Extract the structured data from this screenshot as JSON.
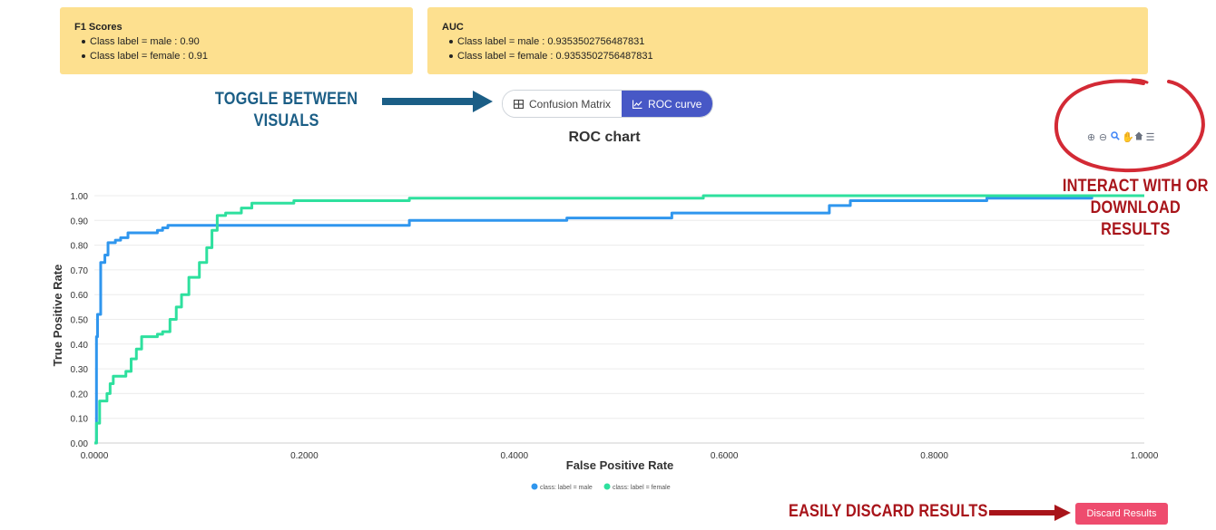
{
  "f1_card": {
    "title": "F1 Scores",
    "items": [
      "Class label = male : 0.90",
      "Class label = female : 0.91"
    ]
  },
  "auc_card": {
    "title": "AUC",
    "items": [
      "Class label = male : 0.9353502756487831",
      "Class label = female : 0.9353502756487831"
    ]
  },
  "annotations": {
    "toggle_line1": "TOGGLE BETWEEN",
    "toggle_line2": "VISUALS",
    "interact_line1": "INTERACT WITH OR",
    "interact_line2": "DOWNLOAD RESULTS",
    "discard_note": "EASILY DISCARD RESULTS"
  },
  "toggle": {
    "confusion_label": "Confusion Matrix",
    "roc_label": "ROC curve",
    "active": "ROC curve"
  },
  "toolbar_icons": [
    "zoom-in-icon",
    "zoom-out-icon",
    "zoom-select-icon",
    "pan-icon",
    "home-icon",
    "menu-icon"
  ],
  "discard_button": "Discard Results",
  "colors": {
    "card_bg": "#fde08f",
    "toggle_active": "#4758c6",
    "male": "#2f96ee",
    "female": "#2ee09e",
    "discard_bg": "#ee4c6e",
    "annotation_blue": "#1b5e86",
    "annotation_red": "#a8141a"
  },
  "chart_data": {
    "type": "line",
    "title": "ROC chart",
    "xlabel": "False Positive Rate",
    "ylabel": "True Positive Rate",
    "xlim": [
      0,
      1
    ],
    "ylim": [
      0,
      1
    ],
    "x_ticks": [
      "0.0000",
      "0.2000",
      "0.4000",
      "0.6000",
      "0.8000",
      "1.0000"
    ],
    "y_ticks": [
      "0.00",
      "0.10",
      "0.20",
      "0.30",
      "0.40",
      "0.50",
      "0.60",
      "0.70",
      "0.80",
      "0.90",
      "1.00"
    ],
    "grid": true,
    "legend": "bottom-center",
    "series": [
      {
        "name": "class: label = male",
        "color": "#2f96ee",
        "points": [
          [
            0,
            0
          ],
          [
            0.002,
            0.43
          ],
          [
            0.003,
            0.52
          ],
          [
            0.006,
            0.73
          ],
          [
            0.01,
            0.76
          ],
          [
            0.013,
            0.81
          ],
          [
            0.02,
            0.82
          ],
          [
            0.025,
            0.83
          ],
          [
            0.032,
            0.85
          ],
          [
            0.06,
            0.86
          ],
          [
            0.065,
            0.87
          ],
          [
            0.07,
            0.88
          ],
          [
            0.15,
            0.88
          ],
          [
            0.3,
            0.9
          ],
          [
            0.45,
            0.91
          ],
          [
            0.55,
            0.93
          ],
          [
            0.7,
            0.96
          ],
          [
            0.72,
            0.98
          ],
          [
            0.85,
            0.99
          ],
          [
            0.95,
            1.0
          ],
          [
            1.0,
            1.0
          ]
        ]
      },
      {
        "name": "class: label = female",
        "color": "#2ee09e",
        "points": [
          [
            0,
            0
          ],
          [
            0.002,
            0.08
          ],
          [
            0.005,
            0.17
          ],
          [
            0.012,
            0.2
          ],
          [
            0.015,
            0.24
          ],
          [
            0.018,
            0.27
          ],
          [
            0.03,
            0.29
          ],
          [
            0.035,
            0.34
          ],
          [
            0.04,
            0.38
          ],
          [
            0.045,
            0.43
          ],
          [
            0.06,
            0.44
          ],
          [
            0.065,
            0.45
          ],
          [
            0.072,
            0.5
          ],
          [
            0.078,
            0.55
          ],
          [
            0.083,
            0.6
          ],
          [
            0.09,
            0.67
          ],
          [
            0.1,
            0.73
          ],
          [
            0.107,
            0.79
          ],
          [
            0.112,
            0.86
          ],
          [
            0.117,
            0.92
          ],
          [
            0.125,
            0.93
          ],
          [
            0.14,
            0.95
          ],
          [
            0.15,
            0.97
          ],
          [
            0.19,
            0.98
          ],
          [
            0.3,
            0.99
          ],
          [
            0.58,
            1.0
          ],
          [
            1.0,
            1.0
          ]
        ]
      }
    ]
  }
}
